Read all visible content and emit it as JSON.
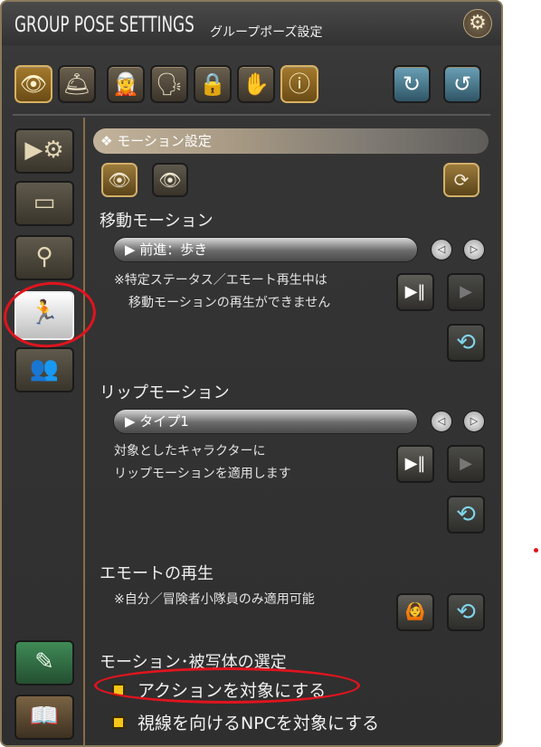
{
  "window": {
    "title": "GROUP POSE SETTINGS",
    "subtitle": "グループポーズ設定",
    "close_icon": "⚙"
  },
  "toolbar": [
    {
      "name": "camera-eye-icon",
      "glyph": "👁"
    },
    {
      "name": "light-icon",
      "glyph": "🛎"
    },
    {
      "name": "character-effect-icon",
      "glyph": "🧝"
    },
    {
      "name": "character-head-icon",
      "glyph": "🗣"
    },
    {
      "name": "time-weather-icon",
      "glyph": "🔒"
    },
    {
      "name": "filter-icon",
      "glyph": "✋"
    },
    {
      "name": "info-icon",
      "glyph": "ⓘ"
    },
    {
      "name": "reset-camera-icon",
      "glyph": "↻"
    },
    {
      "name": "reset-all-icon",
      "glyph": "↺"
    }
  ],
  "sidebar": [
    {
      "name": "sidebar-camera",
      "glyph": "▶⚙"
    },
    {
      "name": "sidebar-frame",
      "glyph": "▭"
    },
    {
      "name": "sidebar-light",
      "glyph": "⚲"
    },
    {
      "name": "sidebar-motion",
      "glyph": "🏃"
    },
    {
      "name": "sidebar-group",
      "glyph": "👥"
    },
    {
      "name": "sidebar-edit-book",
      "glyph": "✎"
    },
    {
      "name": "sidebar-guide-book",
      "glyph": "📖"
    }
  ],
  "section_title": "❖ モーション設定",
  "movement": {
    "label": "移動モーション",
    "selected": "▶ 前進：歩き",
    "note_line1": "※特定ステータス／エモート再生中は",
    "note_line2": "移動モーションの再生ができません"
  },
  "lip": {
    "label": "リップモーション",
    "selected": "▶ タイプ1",
    "note_line1": "対象としたキャラクターに",
    "note_line2": "リップモーションを適用します"
  },
  "emote": {
    "label": "エモートの再生",
    "note": "※自分／冒険者小隊員のみ適用可能"
  },
  "target": {
    "label": "モーション･被写体の選定",
    "option1": "アクションを対象にする",
    "option2": "視線を向けるNPCを対象にする"
  },
  "icons": {
    "arrow_left": "◁",
    "arrow_right": "▷",
    "play": "▶‖",
    "play_group": "▶",
    "reset": "⟲",
    "loop": "⟳",
    "emote_pose": "🙆"
  },
  "colors": {
    "accent_gold": "#c8a24a",
    "annotation_red": "#e0141e",
    "checkbox_yellow": "#f5c518"
  }
}
